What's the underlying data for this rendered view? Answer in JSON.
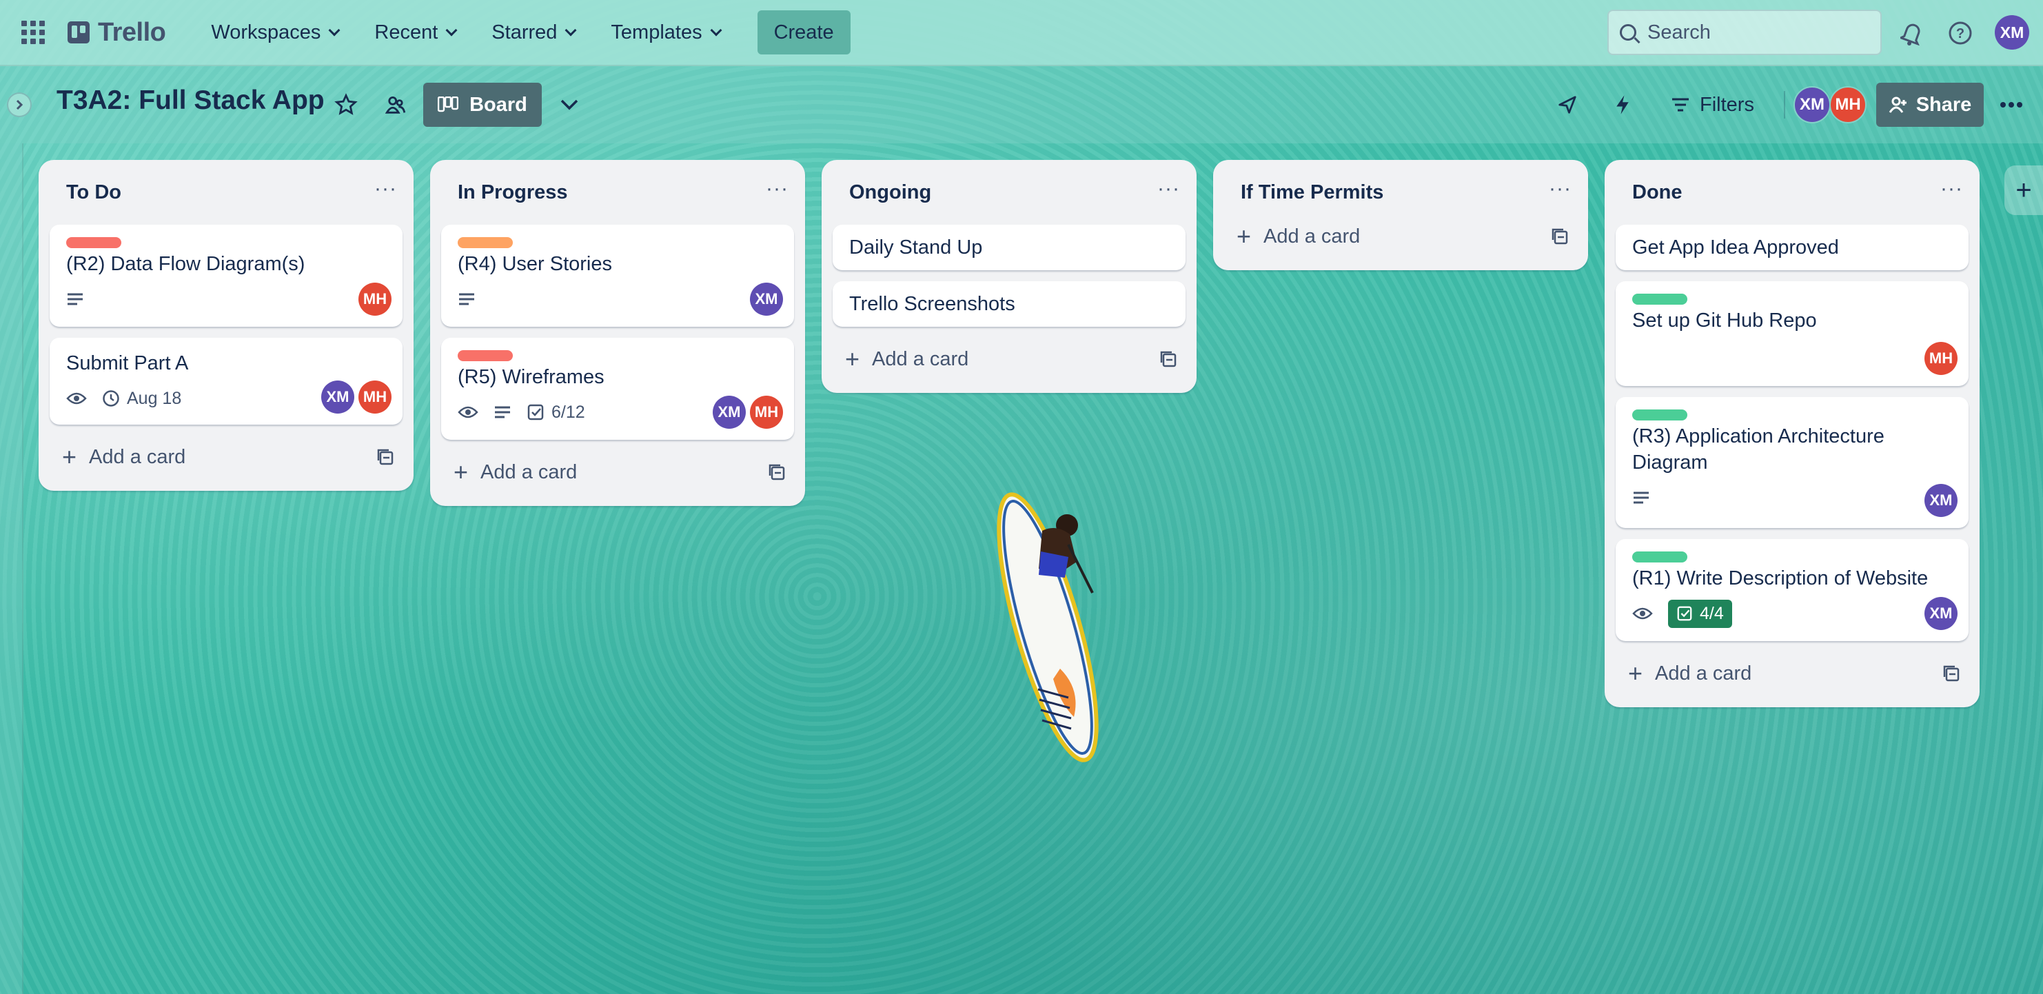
{
  "nav": {
    "logo_text": "Trello",
    "workspaces": "Workspaces",
    "recent": "Recent",
    "starred": "Starred",
    "templates": "Templates",
    "create": "Create",
    "search_placeholder": "Search",
    "user_initials": "XM"
  },
  "board": {
    "title": "T3A2: Full Stack App",
    "view_label": "Board",
    "filters_label": "Filters",
    "share_label": "Share",
    "members": [
      "XM",
      "MH"
    ]
  },
  "lists": [
    {
      "title": "To Do",
      "add_card": "Add a card",
      "cards": [
        {
          "title": "(R2) Data Flow Diagram(s)",
          "label_color": "#f87168",
          "badges": [
            "description-icon"
          ],
          "members": [
            "MH"
          ]
        },
        {
          "title": "Submit Part A",
          "badges": [
            "eye-icon",
            "clock-icon"
          ],
          "due": "Aug 18",
          "members": [
            "XM",
            "MH"
          ]
        }
      ]
    },
    {
      "title": "In Progress",
      "add_card": "Add a card",
      "cards": [
        {
          "title": "(R4) User Stories",
          "label_color": "#fea362",
          "badges": [
            "description-icon"
          ],
          "members": [
            "XM"
          ]
        },
        {
          "title": "(R5) Wireframes",
          "label_color": "#f87168",
          "badges": [
            "eye-icon",
            "description-icon",
            "checklist-icon"
          ],
          "checklist": "6/12",
          "members": [
            "XM",
            "MH"
          ]
        }
      ]
    },
    {
      "title": "Ongoing",
      "add_card": "Add a card",
      "cards": [
        {
          "title": "Daily Stand Up"
        },
        {
          "title": "Trello Screenshots"
        }
      ]
    },
    {
      "title": "If Time Permits",
      "add_card": "Add a card",
      "cards": []
    },
    {
      "title": "Done",
      "add_card": "Add a card",
      "cards": [
        {
          "title": "Get App Idea Approved"
        },
        {
          "title": "Set up Git Hub Repo",
          "label_color": "#4bce97",
          "members": [
            "MH"
          ]
        },
        {
          "title": "(R3) Application Architecture Diagram",
          "label_color": "#4bce97",
          "badges": [
            "description-icon"
          ],
          "members": [
            "XM"
          ]
        },
        {
          "title": "(R1) Write Description of Website",
          "label_color": "#4bce97",
          "badges": [
            "eye-icon",
            "checklist-complete-icon"
          ],
          "checklist": "4/4",
          "members": [
            "XM"
          ]
        }
      ]
    }
  ],
  "colors": {
    "avatar_xm": "#5e4db2",
    "avatar_mh": "#e34935",
    "label_red": "#f87168",
    "label_orange": "#fea362",
    "label_green": "#4bce97",
    "checklist_complete": "#1f845a"
  }
}
